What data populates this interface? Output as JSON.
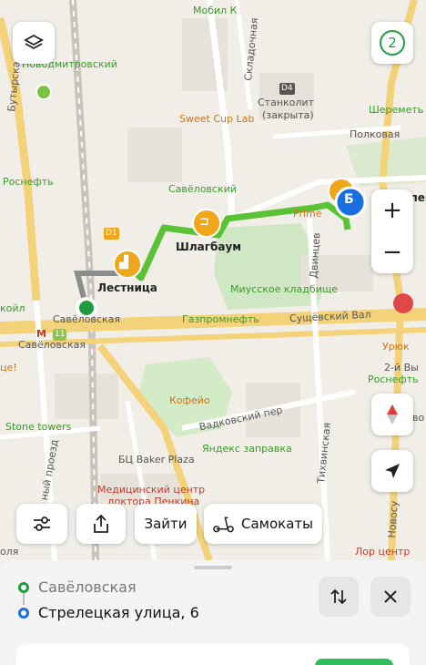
{
  "map": {
    "labels": {
      "mobil": "Мобил К",
      "novodmitrovsky": "Новодмитровский",
      "butyrskaya": "Бутырская",
      "rosneft_left": "Роснефть",
      "skladochnaya": "Складочная",
      "stankolit": "Станколит",
      "stankolit_note": "(закрыта)",
      "sweet_cup": "Sweet Cup Lab",
      "sheremet": "Шереметь",
      "polkovaya": "Полковая",
      "savelovsky": "Савёловский",
      "prime": "Prime",
      "strelets": "лец",
      "shlagbaum": "Шлагбаум",
      "lestnitsa": "Лестница",
      "dvintsev": "Двинцев",
      "koil": "койл",
      "savelovskaya_station": "Савёловская",
      "savelovskaya_metro": "Савёловская",
      "miusskoe": "Миусское кладбище",
      "gazpromneft": "Газпромнефть",
      "sushchevsky_val": "Сущёвский Вал",
      "uryuk": "Урюк",
      "vtoroy_vys": "2-й Вы",
      "rosneft_right": "Роснефть",
      "novo": "Ново",
      "coffeeshop": "Кофейо",
      "stone_towers": "Stone towers",
      "vadkovsky": "Вадковский пер",
      "yandex_zapravka": "Яндекс заправка",
      "tikhvinskaya": "Тихвинская",
      "baker_plaza": "БЦ Baker Plaza",
      "medcenter_1": "Медицинский центр",
      "medcenter_2": "доктора Пенкина",
      "proezd": "ный проезд",
      "novosu": "Новосу",
      "lor": "Лор центр",
      "olya": "оля",
      "ce": "це!",
      "metro_m": "М",
      "metro_num": "11",
      "d1": "D1",
      "d4": "D4"
    },
    "markers": {
      "finish_letter": "Б"
    },
    "layers_count": "2",
    "zoom_in": "+",
    "zoom_out": "−"
  },
  "toolbar": {
    "settings_icon": "sliders-icon",
    "share_icon": "share-icon",
    "enter_label": "Зайти",
    "scooter_label": "Самокаты"
  },
  "route": {
    "from": "Савёловская",
    "to": "Стрелецкая улица, 6"
  },
  "colors": {
    "route": "#5bc236",
    "start": "#1f9d3e",
    "finish": "#1a6fe0",
    "stairs": "#f0a51a",
    "walk": "#8c8c8c"
  }
}
